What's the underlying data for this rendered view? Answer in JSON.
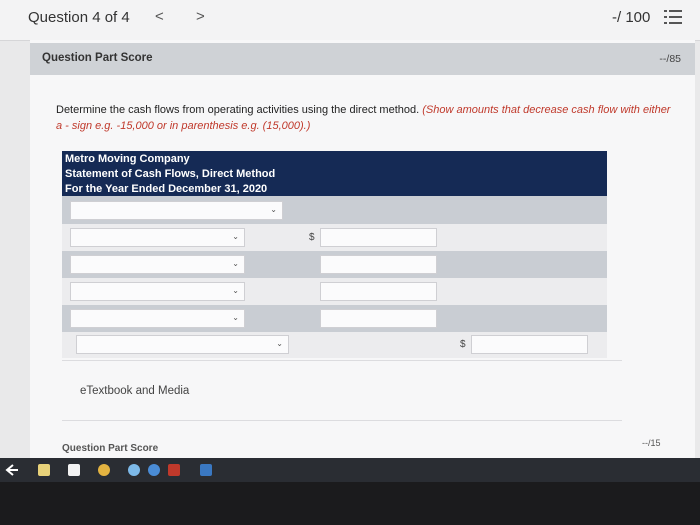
{
  "topbar": {
    "question_title": "Question 4 of 4",
    "prev_glyph": "<",
    "next_glyph": ">",
    "score": "-/ 100"
  },
  "part_header": {
    "label": "Question Part Score",
    "score": "--/85"
  },
  "instructions": {
    "main": "Determine the cash flows from operating activities using the direct method.",
    "note": "(Show amounts that decrease cash flow with either a - sign e.g. -15,000 or in parenthesis e.g. (15,000).)"
  },
  "statement": {
    "company": "Metro Moving Company",
    "title": "Statement of Cash Flows, Direct Method",
    "period": "For the Year Ended December 31, 2020"
  },
  "form": {
    "currency_symbol": "$",
    "select_value": "",
    "amount_value": ""
  },
  "links": {
    "etextbook": "eTextbook and Media"
  },
  "bottom": {
    "label": "Question Part Score",
    "score": "--/15"
  },
  "icons": {
    "chevron": "⌄",
    "list": "list-icon"
  }
}
